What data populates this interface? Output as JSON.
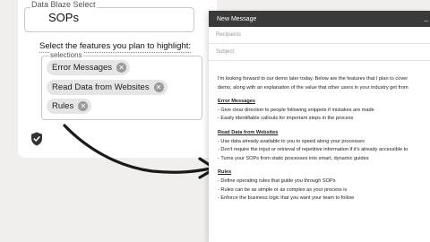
{
  "form": {
    "select_legend": "Data Blaze Select",
    "select_value": "SOPs",
    "feature_prompt": "Select the features you plan to highlight:",
    "selections_legend": "selections",
    "chips": [
      {
        "label": "Error Messages"
      },
      {
        "label": "Read Data from Websites"
      },
      {
        "label": "Rules"
      }
    ]
  },
  "icons": {
    "shield": "shield-check-icon",
    "chip_remove": "close-circle-icon",
    "minimize": "minimize-icon"
  },
  "message": {
    "title": "New Message",
    "minimize_glyph": "_",
    "recipients_placeholder": "Recipients",
    "subject_placeholder": "Subject",
    "intro_1": "I'm looking forward to our demo later today. Below are the features that I plan to cover",
    "intro_2": "demo, along with an explanation of the value that other users in your industry get from",
    "sections": [
      {
        "heading": "Error Messages",
        "lines": [
          "- Give clear direction to people following snippets if mistakes are made",
          "- Easily identifiable callouts for important steps in the process"
        ]
      },
      {
        "heading": "Read Data from Websites",
        "lines": [
          "- Use data already available to you to speed along your processes",
          "- Don't require the input or retrieval of repetitive information if it's already accessible to",
          "- Turns your SOPs from static processes into smart, dynamic guides"
        ]
      },
      {
        "heading": "Rules",
        "lines": [
          "- Define operating rules that guide you through SOPs",
          "- Rules can be as simple or as complex as your process is",
          "- Enforce the business logic that you want your team to follow"
        ]
      }
    ]
  },
  "colors": {
    "background": "#f1eeee",
    "titlebar": "#3a3a3a",
    "chip": "#e5e5e5"
  }
}
